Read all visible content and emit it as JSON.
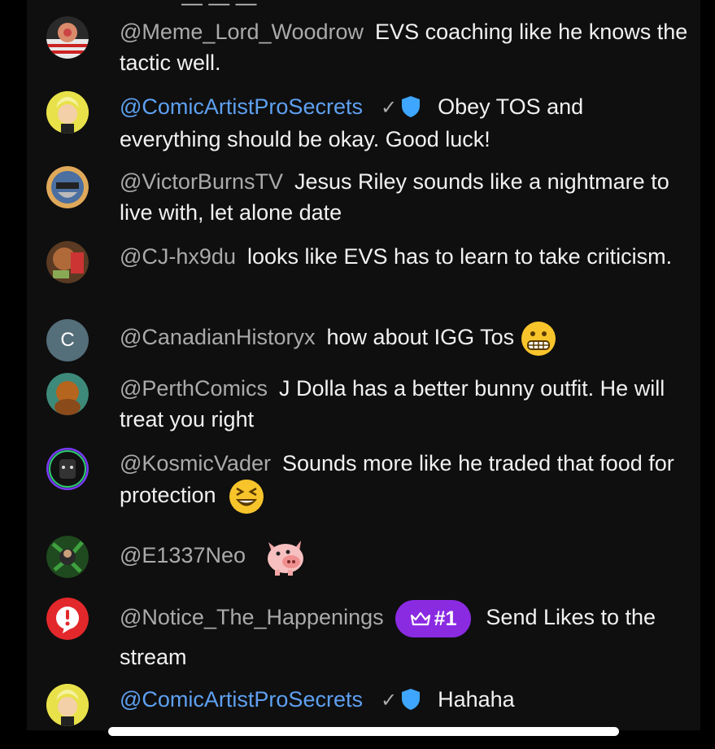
{
  "messages": [
    {
      "author": "@Meme_Lord_Woodrow",
      "text": "EVS coaching like he knows the tactic well."
    },
    {
      "author": "@ComicArtistProSecrets",
      "text": "Obey TOS and everything should be okay. Good luck!",
      "moderator": true
    },
    {
      "author": "@VictorBurnsTV",
      "text": "Jesus Riley sounds like a nightmare to live with, let alone date"
    },
    {
      "author": "@CJ-hx9du",
      "text": "looks like EVS has to learn to take criticism."
    },
    {
      "author": "@CanadianHistoryx",
      "text": "how about IGG Tos",
      "emoji": "grimacing-face",
      "avatar_letter": "C"
    },
    {
      "author": "@PerthComics",
      "text": "J Dolla has a better bunny outfit. He will treat you right"
    },
    {
      "author": "@KosmicVader",
      "text": "Sounds more like he traded that food for protection",
      "emoji": "laughing-squint-face"
    },
    {
      "author": "@E1337Neo",
      "text": "",
      "emoji": "pig-face"
    },
    {
      "author": "@Notice_The_Happenings",
      "badge": "#1",
      "text": "Send Likes to the stream"
    },
    {
      "author": "@ComicArtistProSecrets",
      "text": "Hahaha",
      "moderator": true
    }
  ],
  "colors": {
    "background": "#0f0f0f",
    "author": "#aaaaaa",
    "moderator_author": "#5ea0f0",
    "message_text": "#f1f1f1",
    "badge": "#8a2be2"
  },
  "icons": {
    "verified": "check-icon",
    "moderator": "shield-icon",
    "badge": "crown-icon"
  }
}
